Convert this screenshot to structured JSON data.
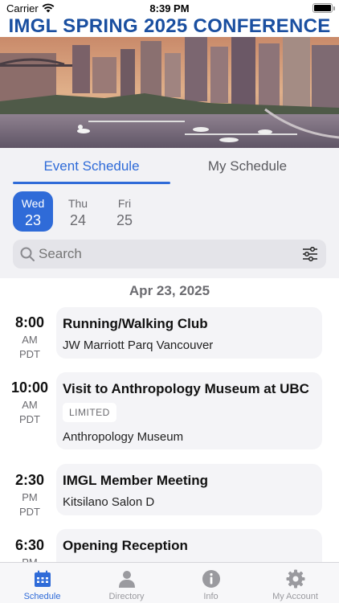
{
  "status_bar": {
    "carrier": "Carrier",
    "time": "8:39 PM"
  },
  "header": {
    "title": "IMGL SPRING 2025 CONFERENCE"
  },
  "tabs": [
    {
      "label": "Event Schedule",
      "active": true
    },
    {
      "label": "My Schedule",
      "active": false
    }
  ],
  "days": [
    {
      "name": "Wed",
      "num": "23",
      "selected": true
    },
    {
      "name": "Thu",
      "num": "24",
      "selected": false
    },
    {
      "name": "Fri",
      "num": "25",
      "selected": false
    }
  ],
  "search": {
    "placeholder": "Search"
  },
  "date_header": "Apr 23, 2025",
  "events": [
    {
      "time": "8:00",
      "ampm": "AM",
      "tz": "PDT",
      "title": "Running/Walking Club",
      "location": "JW Marriott Parq Vancouver"
    },
    {
      "time": "10:00",
      "ampm": "AM",
      "tz": "PDT",
      "title": "Visit to Anthropology Museum at UBC",
      "badge": "LIMITED",
      "location": "Anthropology Museum"
    },
    {
      "time": "2:30",
      "ampm": "PM",
      "tz": "PDT",
      "title": "IMGL Member Meeting",
      "location": "Kitsilano Salon D"
    },
    {
      "time": "6:30",
      "ampm": "PM",
      "tz": "",
      "title": "Opening Reception",
      "location": ""
    }
  ],
  "nav": [
    {
      "label": "Schedule",
      "icon": "calendar-icon",
      "active": true
    },
    {
      "label": "Directory",
      "icon": "person-icon",
      "active": false
    },
    {
      "label": "Info",
      "icon": "info-icon",
      "active": false
    },
    {
      "label": "My Account",
      "icon": "gear-icon",
      "active": false
    }
  ],
  "colors": {
    "accent": "#2f6bd8",
    "title": "#1a4fa0",
    "card": "#f4f4f7",
    "panel": "#f2f2f5"
  }
}
